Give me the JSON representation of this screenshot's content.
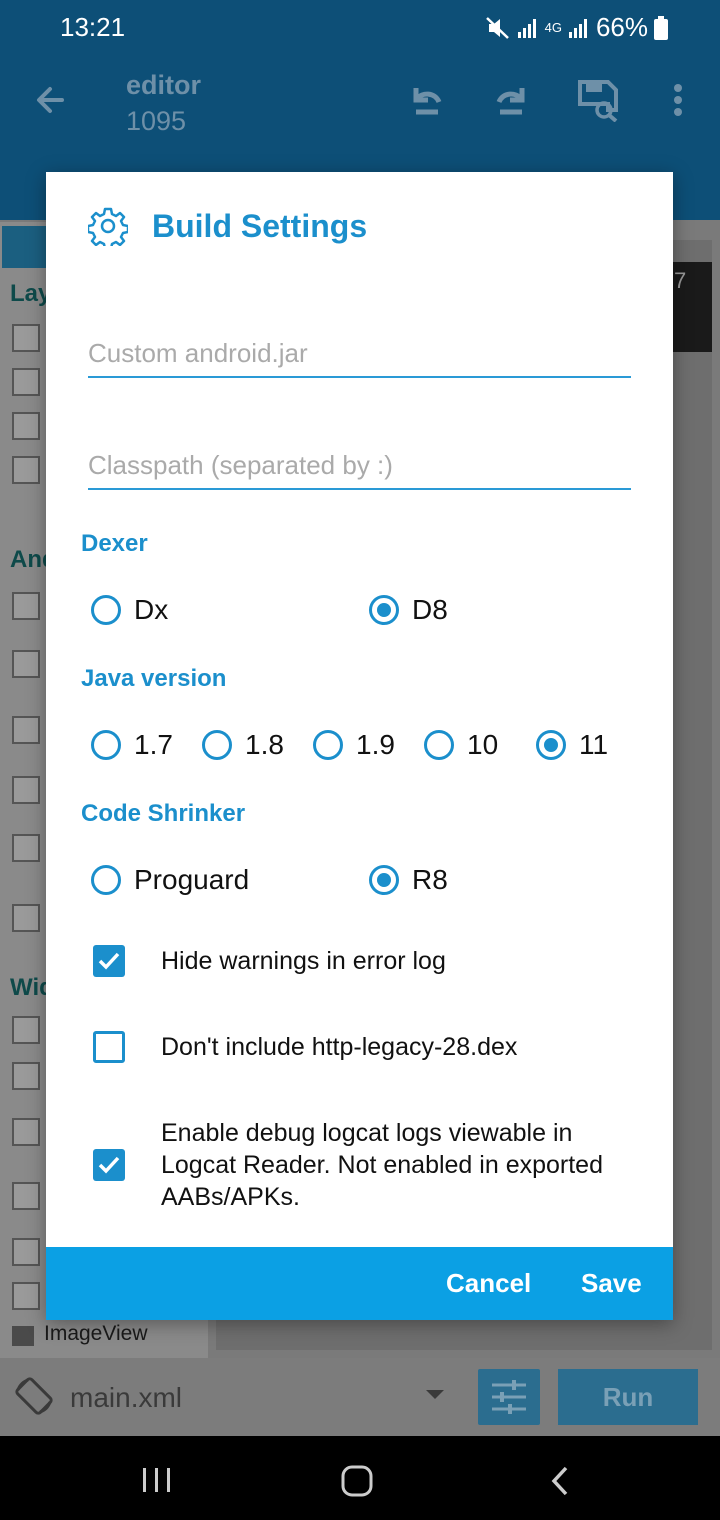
{
  "status_bar": {
    "time": "13:21",
    "battery": "66%",
    "network": "4G"
  },
  "app_bar": {
    "title": "editor",
    "subtitle": "1095"
  },
  "background": {
    "palette_headers": [
      "Lay",
      "And",
      "Wid"
    ],
    "preview_number": "7",
    "imageview_label": "ImageView"
  },
  "bottom_bar": {
    "file": "main.xml",
    "run_label": "Run"
  },
  "dialog": {
    "title": "Build Settings",
    "fields": {
      "android_jar_placeholder": "Custom android.jar",
      "classpath_placeholder": "Classpath (separated by :)"
    },
    "dexer": {
      "label": "Dexer",
      "options": [
        "Dx",
        "D8"
      ],
      "selected": "D8"
    },
    "java_version": {
      "label": "Java version",
      "options": [
        "1.7",
        "1.8",
        "1.9",
        "10",
        "11"
      ],
      "selected": "11"
    },
    "code_shrinker": {
      "label": "Code Shrinker",
      "options": [
        "Proguard",
        "R8"
      ],
      "selected": "R8"
    },
    "checkboxes": [
      {
        "label": "Hide warnings in error log",
        "checked": true
      },
      {
        "label": "Don't include http-legacy-28.dex",
        "checked": false
      },
      {
        "label": "Enable debug logcat logs viewable in Logcat Reader. Not enabled in exported AABs/APKs.",
        "checked": true
      }
    ],
    "buttons": {
      "cancel": "Cancel",
      "save": "Save"
    }
  },
  "colors": {
    "primary_dark": "#0d4f77",
    "accent": "#1b8fcc",
    "footer": "#0ba0e4"
  }
}
